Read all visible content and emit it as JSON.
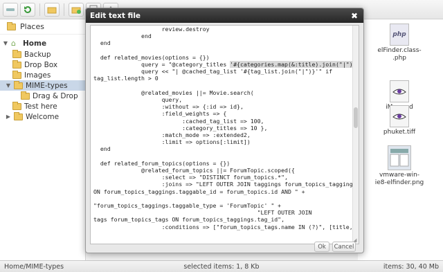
{
  "toolbar": {
    "buttons": [
      "back-icon",
      "reload-icon",
      "open-folder-icon",
      "new-folder-icon",
      "new-file-icon",
      "upload-icon"
    ]
  },
  "sidebar": {
    "places_label": "Places",
    "items": [
      {
        "label": "Home",
        "level": 0,
        "expanded": true
      },
      {
        "label": "Backup",
        "level": 1
      },
      {
        "label": "Drop Box",
        "level": 1
      },
      {
        "label": "Images",
        "level": 1
      },
      {
        "label": "MIME-types",
        "level": 1,
        "selected": true,
        "expanded": true
      },
      {
        "label": "Drag & Drop",
        "level": 2
      },
      {
        "label": "Test here",
        "level": 1
      },
      {
        "label": "Welcome",
        "level": 1,
        "collapsed": true
      }
    ]
  },
  "files": [
    {
      "name": "elFinder.class-.php",
      "line1": "elFinder.class-",
      "line2": ".php",
      "icon": "php-file-icon",
      "badge": "php"
    },
    {
      "name": "iMac.psd",
      "line1": "iMac.psd",
      "line2": "",
      "icon": "psd-file-icon",
      "badge": ""
    },
    {
      "name": "phuket.tiff",
      "line1": "phuket.tiff",
      "line2": "",
      "icon": "tiff-file-icon",
      "badge": ""
    },
    {
      "name": "vmware-win-ie8-elfinder.png",
      "line1": "vmware-win-",
      "line2": "ie8-elfinder.png",
      "icon": "image-thumbnail-icon",
      "badge": ""
    }
  ],
  "statusbar": {
    "path": "Home/MIME-types",
    "selected": "selected items: 1, 8 Kb",
    "items": "items: 30, 40 Mb"
  },
  "dialog": {
    "title": "Edit text file",
    "ok_label": "Ok",
    "cancel_label": "Cancel",
    "code_lines": [
      "                    review.destroy",
      "              end",
      "  end",
      "",
      "  def related_movies(options = {})",
      "              query = \"@category_titles '#{categories.map(&:title).join(\"|\")}' \"",
      "              query << \"| @cached_tag_list '#{tag_list.join(\"|\")}'\" if",
      "tag_list.length > 0",
      "",
      "              @related_movies ||= Movie.search(",
      "                    query,",
      "                    :without => {:id => id},",
      "                    :field_weights => {",
      "                          :cached_tag_list => 100,",
      "                          :category_titles => 10 },",
      "                    :match_mode => :extended2,",
      "                    :limit => options[:limit])",
      "  end",
      "",
      "  def related_forum_topics(options = {})",
      "              @related_forum_topics ||= ForumTopic.scoped({",
      "                    :select => \"DISTINCT forum_topics.*\",",
      "                    :joins => \"LEFT OUTER JOIN taggings forum_topics_taggings",
      "ON forum_topics_taggings.taggable_id = forum_topics.id AND \" +",
      "",
      "\"forum_topics_taggings.taggable_type = 'ForumTopic' \" +",
      "                                                \"LEFT OUTER JOIN",
      "tags forum_topics_tags ON forum_topics_taggings.tag_id\",",
      "                    :conditions => [\"forum_topics_tags.name IN (?)\", [title,"
    ]
  }
}
